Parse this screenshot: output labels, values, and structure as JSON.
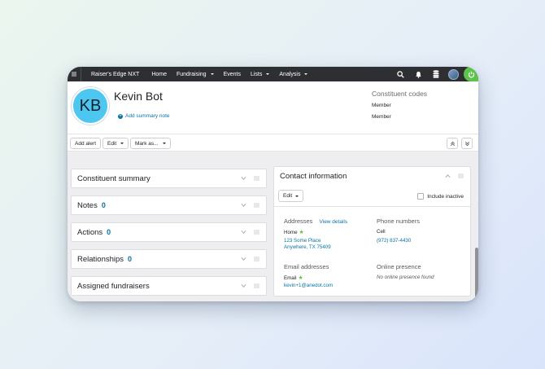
{
  "nav": {
    "brand": "Raiser's Edge NXT",
    "items": [
      {
        "label": "Home",
        "caret": false
      },
      {
        "label": "Fundraising",
        "caret": true
      },
      {
        "label": "Events",
        "caret": false
      },
      {
        "label": "Lists",
        "caret": true
      },
      {
        "label": "Analysis",
        "caret": true
      }
    ]
  },
  "header": {
    "initials": "KB",
    "name": "Kevin Bot",
    "add_note": "Add summary note",
    "codes_title": "Constituent codes",
    "codes": [
      "Member",
      "Member"
    ]
  },
  "toolbar": {
    "add_alert": "Add alert",
    "edit": "Edit",
    "mark_as": "Mark as..."
  },
  "tiles": [
    {
      "title": "Constituent summary",
      "count": ""
    },
    {
      "title": "Notes",
      "count": "0"
    },
    {
      "title": "Actions",
      "count": "0"
    },
    {
      "title": "Relationships",
      "count": "0"
    },
    {
      "title": "Assigned fundraisers",
      "count": ""
    }
  ],
  "contact": {
    "title": "Contact information",
    "edit": "Edit",
    "include_inactive": "Include inactive",
    "addresses_title": "Addresses",
    "view_details": "View details",
    "address_type": "Home",
    "address_line1": "123 Some Place",
    "address_line2": "Anywhere, TX  75409",
    "phone_title": "Phone numbers",
    "phone_type": "Cell",
    "phone": "(972) 837-4430",
    "email_title": "Email addresses",
    "email_type": "Email",
    "email": "kevin+1@anedot.com",
    "online_title": "Online presence",
    "online_empty": "No online presence found"
  },
  "colors": {
    "nav_bg": "#2d2f33",
    "avatar": "#4ec7f0",
    "link": "#0974a1",
    "primary_star": "#6ac04b",
    "power": "#5cc44a"
  }
}
